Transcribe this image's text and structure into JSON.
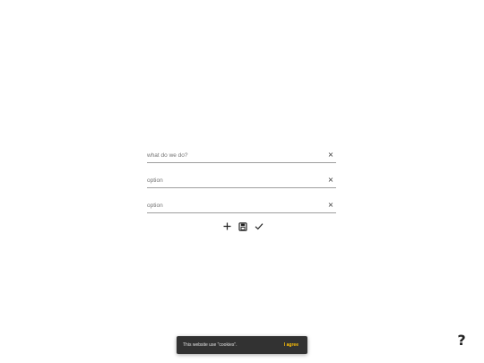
{
  "form": {
    "question": {
      "value": "",
      "placeholder": "what do we do?"
    },
    "options": [
      {
        "value": "",
        "placeholder": "option"
      },
      {
        "value": "",
        "placeholder": "option"
      }
    ],
    "clear_glyph": "×",
    "actions": {
      "add_icon": "plus-icon",
      "save_icon": "save-icon",
      "submit_icon": "check-icon"
    }
  },
  "cookie_banner": {
    "text": "This website use \"cookies\".",
    "agree_label": "I agree"
  },
  "help": {
    "label": "?"
  },
  "colors": {
    "accent": "#ffc107",
    "snackbar_bg": "#323232",
    "underline": "#9e9e9e"
  }
}
